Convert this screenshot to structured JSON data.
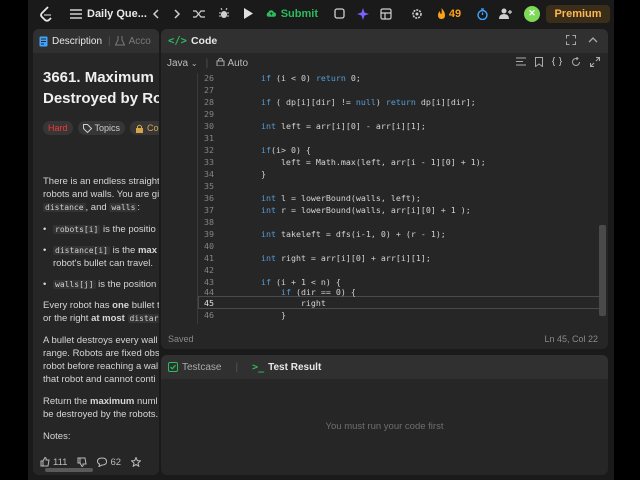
{
  "topbar": {
    "problem_list_label": "Daily Que...",
    "submit_label": "Submit",
    "streak_count": "49",
    "premium_label": "Premium"
  },
  "problem": {
    "tabs": [
      {
        "label": "Description"
      },
      {
        "label": "Acco"
      }
    ],
    "title_line1": "3661. Maximum",
    "title_line2": "Destroyed by Ro",
    "tags": {
      "difficulty": "Hard",
      "topics": "Topics",
      "companies": "Comp"
    },
    "desc": {
      "p1_a": "There is an endless straight",
      "p1_b": "robots and walls. You are gi",
      "p1_code1": "distance",
      "p1_c": ", and ",
      "p1_code2": "walls",
      "p1_d": ":",
      "b1_code": "robots[i]",
      "b1_text": " is the positio",
      "b2_code": "distance[i]",
      "b2_text1": " is the ",
      "b2_bold": "max",
      "b2_text2": "robot's bullet can travel.",
      "b3_code": "walls[j]",
      "b3_text": " is the position",
      "p2_a": "Every robot has ",
      "p2_bold1": "one",
      "p2_b": " bullet t",
      "p2_c": "or the right ",
      "p2_bold2": "at most",
      "p2_code": "distar",
      "p3_a": "A bullet destroys every wall",
      "p3_b": "range. Robots are fixed obs",
      "p3_c": "robot before reaching a wal",
      "p3_d": "that robot and cannot conti",
      "p4_a": "Return the ",
      "p4_bold": "maximum",
      "p4_b": " numl",
      "p4_c": "be destroyed by the robots.",
      "notes": "Notes:"
    },
    "bottom": {
      "likes": "111",
      "comments": "62"
    }
  },
  "code": {
    "title": "Code",
    "language": "Java",
    "mode": "Auto",
    "lines": [
      {
        "num": "26",
        "text": "        if (i < 0) return 0;"
      },
      {
        "num": "27",
        "text": ""
      },
      {
        "num": "28",
        "text": "        if ( dp[i][dir] != null) return dp[i][dir];"
      },
      {
        "num": "29",
        "text": ""
      },
      {
        "num": "30",
        "text": "        int left = arr[i][0] - arr[i][1];"
      },
      {
        "num": "31",
        "text": ""
      },
      {
        "num": "32",
        "text": "        if(i> 0) {"
      },
      {
        "num": "33",
        "text": "            left = Math.max(left, arr[i - 1][0] + 1);"
      },
      {
        "num": "34",
        "text": "        }"
      },
      {
        "num": "35",
        "text": ""
      },
      {
        "num": "36",
        "text": "        int l = lowerBound(walls, left);"
      },
      {
        "num": "37",
        "text": "        int r = lowerBound(walls, arr[i][0] + 1 );"
      },
      {
        "num": "38",
        "text": ""
      },
      {
        "num": "39",
        "text": "        int takeleft = dfs(i-1, 0) + (r - 1);"
      },
      {
        "num": "40",
        "text": ""
      },
      {
        "num": "41",
        "text": "        int right = arr[i][0] + arr[i][1];"
      },
      {
        "num": "42",
        "text": ""
      },
      {
        "num": "43",
        "text": "        if (i + 1 < n) {"
      },
      {
        "num": "44",
        "text": "            if (dir == 0) {"
      },
      {
        "num": "45",
        "text": "                right"
      },
      {
        "num": "46",
        "text": "            }"
      }
    ],
    "status": "Saved",
    "cursor": "Ln 45, Col 22"
  },
  "tests": {
    "tab_testcase": "Testcase",
    "tab_result": "Test Result",
    "message": "You must run your code first"
  },
  "colors": {
    "accent_green": "#2cbb5d",
    "streak_orange": "#ffa116",
    "hard_red": "#f63737"
  }
}
